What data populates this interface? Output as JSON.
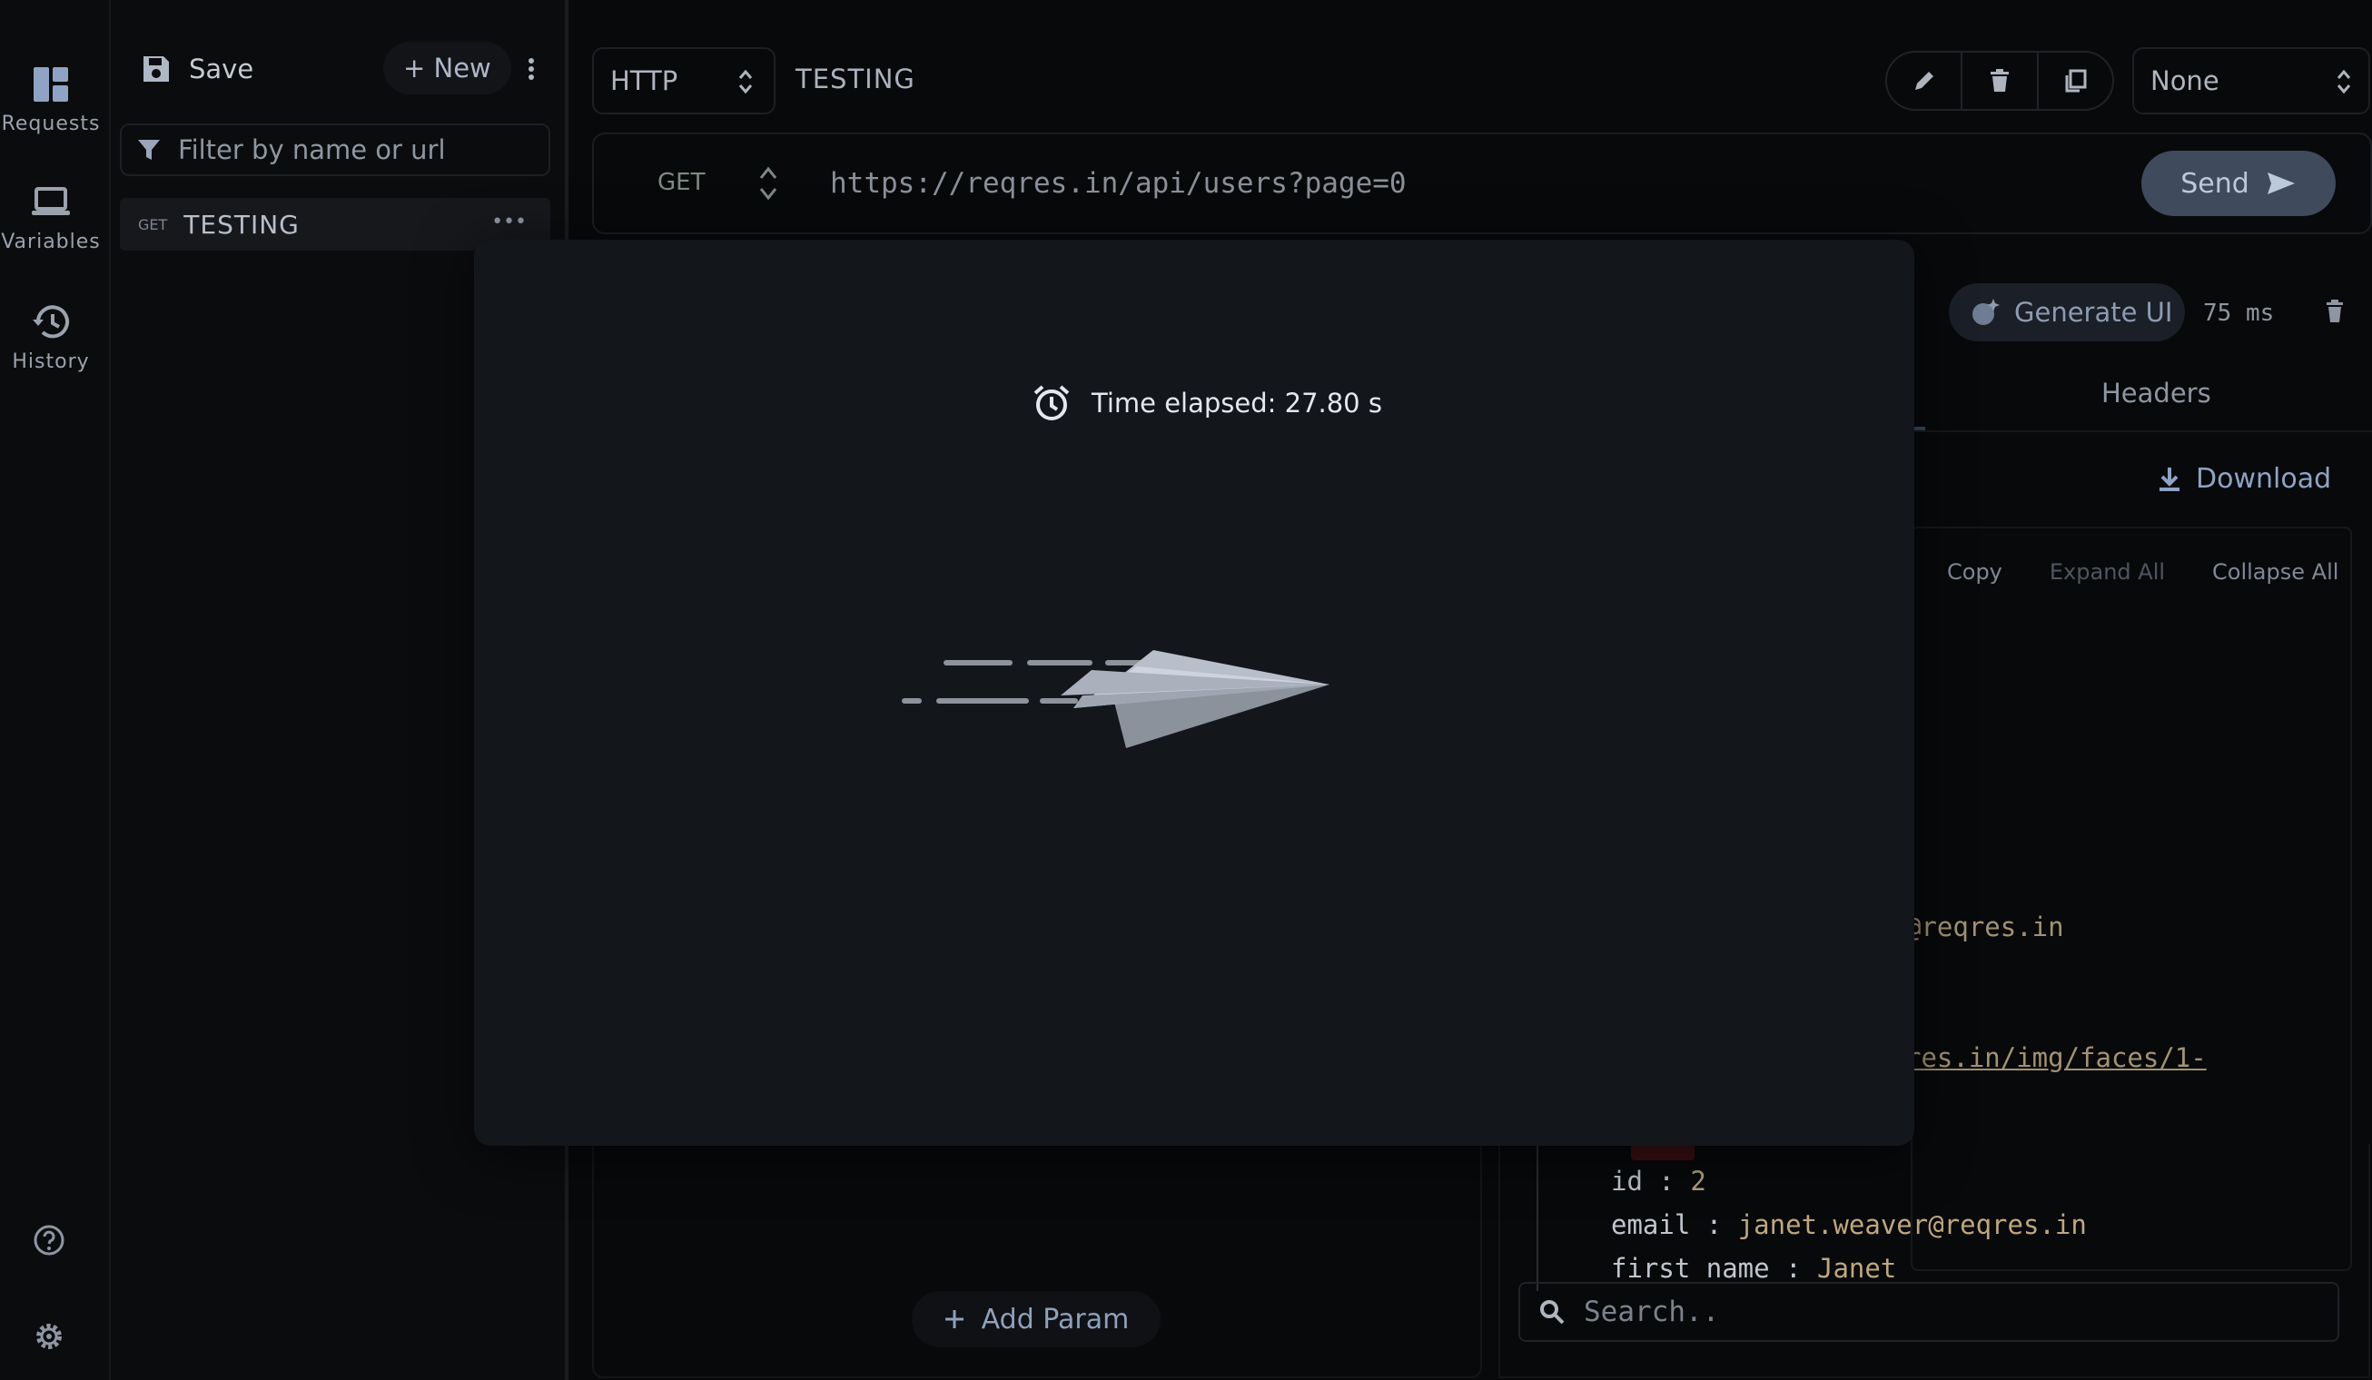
{
  "rail": {
    "requests_label": "Requests",
    "variables_label": "Variables",
    "history_label": "History",
    "icons": [
      "dashboard-icon",
      "laptop-icon",
      "history-icon",
      "help-icon",
      "gear-icon"
    ]
  },
  "sidebar": {
    "save_label": "Save",
    "new_label": "+ New",
    "filter_placeholder": "Filter by name or url",
    "requests": [
      {
        "method": "GET",
        "name": "TESTING"
      }
    ]
  },
  "toolbar": {
    "protocol": "HTTP",
    "request_title": "TESTING",
    "environment": "None"
  },
  "request": {
    "method": "GET",
    "url": "https://reqres.in/api/users?page=0",
    "send_label": "Send",
    "add_param_label": "Add Param"
  },
  "response": {
    "generate_ui_label": "Generate UI",
    "time": "75 ms",
    "headers_tab": "Headers",
    "download_label": "Download",
    "copy_label": "Copy",
    "expand_all_label": "Expand All",
    "collapse_all_label": "Collapse All",
    "partial_email": "@reqres.in",
    "partial_avatar": "res.in/img/faces/1-",
    "entry": {
      "id_key": "id",
      "id_value": "2",
      "email_key": "email",
      "email_value": "janet.weaver@reqres.in",
      "first_name_key": "first_name",
      "first_name_value": "Janet"
    },
    "search_placeholder": "Search.."
  },
  "modal": {
    "elapsed_text": "Time elapsed: 27.80 s"
  },
  "colors": {
    "background": "#08090b",
    "modal": "#13161b",
    "send_button": "#3f4a5c",
    "json_value": "#bfa77e"
  }
}
